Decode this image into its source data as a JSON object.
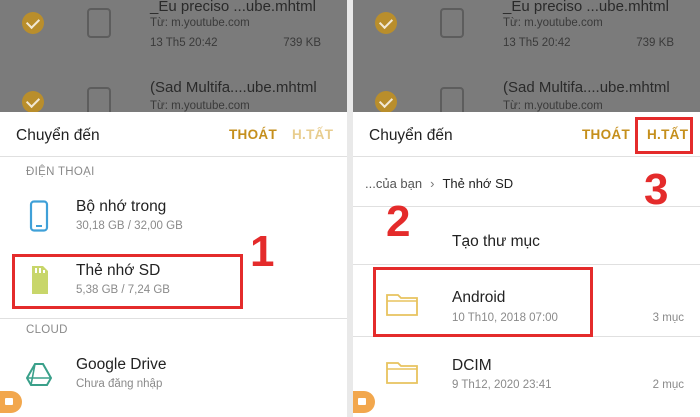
{
  "backdrop_files": [
    {
      "name": "_Eu preciso ...ube.mhtml",
      "source": "Từ: m.youtube.com",
      "date": "13 Th5 20:42",
      "size": "739 KB"
    },
    {
      "name": "(Sad Multifa....ube.mhtml",
      "source": "Từ: m.youtube.com"
    }
  ],
  "left_panel": {
    "title": "Chuyển đến",
    "exit_label": "THOÁT",
    "done_label": "H.TẤT",
    "sections": {
      "phone": "ĐIỆN THOẠI",
      "cloud": "CLOUD"
    },
    "items": [
      {
        "label": "Bộ nhớ trong",
        "sub": "30,18 GB / 32,00 GB",
        "icon": "phone-icon"
      },
      {
        "label": "Thẻ nhớ SD",
        "sub": "5,38 GB / 7,24 GB",
        "icon": "sd-card-icon"
      },
      {
        "label": "Google Drive",
        "sub": "Chưa đăng nhập",
        "icon": "google-drive-icon"
      }
    ],
    "step": "1"
  },
  "right_panel": {
    "title": "Chuyển đến",
    "exit_label": "THOÁT",
    "done_label": "H.TẤT",
    "breadcrumb": {
      "parent": "...của bạn",
      "current": "Thẻ nhớ SD"
    },
    "new_folder_label": "Tạo thư mục",
    "folders": [
      {
        "name": "Android",
        "date": "10 Th10, 2018 07:00",
        "count": "3 mục"
      },
      {
        "name": "DCIM",
        "date": "9 Th12, 2020 23:41",
        "count": "2 mục"
      }
    ],
    "step_2": "2",
    "step_3": "3"
  },
  "colors": {
    "accent": "#c58f1c",
    "highlight": "#e42b2b",
    "folder": "#f4d98a"
  }
}
